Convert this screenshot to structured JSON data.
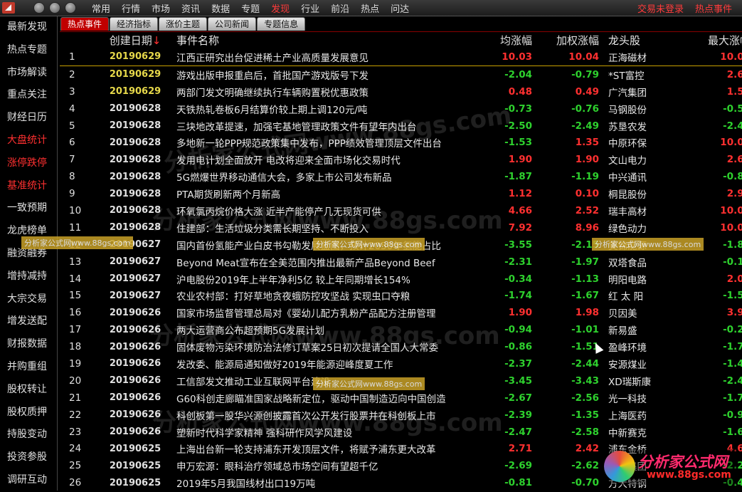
{
  "menu": {
    "items": [
      "常用",
      "行情",
      "市场",
      "资讯",
      "数据",
      "专题",
      "发现",
      "行业",
      "前沿",
      "热点",
      "问达"
    ],
    "active_index": 6,
    "login_status": "交易未登录",
    "hot_events": "热点事件"
  },
  "sidebar": {
    "items": [
      {
        "label": "最新发现",
        "red": false
      },
      {
        "label": "热点专题",
        "red": false
      },
      {
        "label": "市场解读",
        "red": false
      },
      {
        "label": "重点关注",
        "red": false
      },
      {
        "label": "财经日历",
        "red": false
      },
      {
        "label": "大盘统计",
        "red": true
      },
      {
        "label": "涨停跌停",
        "red": true
      },
      {
        "label": "基准统计",
        "red": true
      },
      {
        "label": "一致预期",
        "red": false
      },
      {
        "label": "龙虎榜单",
        "red": false
      },
      {
        "label": "融资融券",
        "red": false
      },
      {
        "label": "增持减持",
        "red": false
      },
      {
        "label": "大宗交易",
        "red": false
      },
      {
        "label": "增发送配",
        "red": false
      },
      {
        "label": "财报数据",
        "red": false
      },
      {
        "label": "并购重组",
        "red": false
      },
      {
        "label": "股权转让",
        "red": false
      },
      {
        "label": "股权质押",
        "red": false
      },
      {
        "label": "持股变动",
        "red": false
      },
      {
        "label": "投资参股",
        "red": false
      },
      {
        "label": "调研互动",
        "red": false
      }
    ]
  },
  "tabs": [
    "热点事件",
    "经济指标",
    "涨价主题",
    "公司新闻",
    "专题信息"
  ],
  "table": {
    "headers": {
      "no": "",
      "date": "创建日期",
      "sort_arrow": "↓",
      "name": "事件名称",
      "avg": "均涨幅",
      "weighted": "加权涨幅",
      "leader": "龙头股",
      "max": "最大涨幅"
    },
    "rows": [
      {
        "no": "1",
        "date": "20190629",
        "name": "江西正研究出台促进稀土产业高质量发展意见",
        "avg": "10.03",
        "w": "10.04",
        "leader": "正海磁材",
        "max": "10.05"
      },
      {
        "no": "2",
        "date": "20190629",
        "name": "游戏出版申报重启后，首批国产游戏版号下发",
        "avg": "-2.04",
        "w": "-0.79",
        "leader": "*ST富控",
        "max": "2.68"
      },
      {
        "no": "3",
        "date": "20190629",
        "name": "两部门发文明确继续执行车辆购置税优惠政策",
        "avg": "0.48",
        "w": "0.49",
        "leader": "广汽集团",
        "max": "1.58"
      },
      {
        "no": "4",
        "date": "20190628",
        "name": "天铁热轧卷板6月结算价较上期上调120元/吨",
        "avg": "-0.73",
        "w": "-0.76",
        "leader": "马钢股份",
        "max": "-0.58"
      },
      {
        "no": "5",
        "date": "20190628",
        "name": "三块地改革提速，加强宅基地管理政策文件有望年内出台",
        "avg": "-2.50",
        "w": "-2.49",
        "leader": "苏垦农发",
        "max": "-2.41"
      },
      {
        "no": "6",
        "date": "20190628",
        "name": "多地新一轮PPP规范政策集中发布，PPP绩效管理顶层文件出台",
        "avg": "-1.53",
        "w": "1.35",
        "leader": "中原环保",
        "max": "10.03"
      },
      {
        "no": "7",
        "date": "20190628",
        "name": "发用电计划全面放开 电改将迎来全面市场化交易时代",
        "avg": "1.90",
        "w": "1.90",
        "leader": "文山电力",
        "max": "2.68"
      },
      {
        "no": "8",
        "date": "20190628",
        "name": "5G燃爆世界移动通信大会，多家上市公司发布新品",
        "avg": "-1.87",
        "w": "-1.19",
        "leader": "中兴通讯",
        "max": "-0.85"
      },
      {
        "no": "9",
        "date": "20190628",
        "name": "PTA期货刷新两个月新高",
        "avg": "1.12",
        "w": "0.10",
        "leader": "桐昆股份",
        "max": "2.99"
      },
      {
        "no": "10",
        "date": "20190628",
        "name": "环氧氯丙烷价格大涨 近半产能停产几无现货可供",
        "avg": "4.66",
        "w": "2.52",
        "leader": "瑞丰高材",
        "max": "10.01"
      },
      {
        "no": "11",
        "date": "20190628",
        "name": "住建部：生活垃圾分类需长期坚持、不断投入",
        "avg": "7.92",
        "w": "8.96",
        "leader": "绿色动力",
        "max": "10.00"
      },
      {
        "no": "12",
        "date": "20190627",
        "name": "国内首份氢能产业白皮书勾勒发展蓝图，预计2050年氢能占比",
        "avg": "-3.55",
        "w": "-2.15",
        "leader": "美锦能源",
        "max": "-1.88"
      },
      {
        "no": "13",
        "date": "20190627",
        "name": "Beyond Meat宣布在全美范围内推出最新产品Beyond Beef",
        "avg": "-2.31",
        "w": "-1.97",
        "leader": "双塔食品",
        "max": "-0.14"
      },
      {
        "no": "14",
        "date": "20190627",
        "name": "沪电股份2019年上半年净利5亿 较上年同期增长154%",
        "avg": "-0.34",
        "w": "-1.13",
        "leader": "明阳电路",
        "max": "2.04"
      },
      {
        "no": "15",
        "date": "20190627",
        "name": "农业农村部：打好草地贪夜蛾防控攻坚战 实现虫口夺粮",
        "avg": "-1.74",
        "w": "-1.67",
        "leader": "红 太 阳",
        "max": "-1.53"
      },
      {
        "no": "16",
        "date": "20190626",
        "name": "国家市场监督管理总局对《婴幼儿配方乳粉产品配方注册管理",
        "avg": "1.90",
        "w": "1.98",
        "leader": "贝因美",
        "max": "3.99"
      },
      {
        "no": "17",
        "date": "20190626",
        "name": "两大运营商公布超预期5G发展计划",
        "avg": "-0.94",
        "w": "-1.01",
        "leader": "新易盛",
        "max": "-0.24"
      },
      {
        "no": "18",
        "date": "20190626",
        "name": "固体废物污染环境防治法修订草案25日初次提请全国人大常委",
        "avg": "-0.86",
        "w": "-1.51",
        "leader": "盈峰环境",
        "max": "-1.73"
      },
      {
        "no": "19",
        "date": "20190626",
        "name": "发改委、能源局通知做好2019年能源迎峰度夏工作",
        "avg": "-2.37",
        "w": "-2.44",
        "leader": "安源煤业",
        "max": "-1.46"
      },
      {
        "no": "20",
        "date": "20190626",
        "name": "工信部发文推动工业互联网平台建设",
        "avg": "-3.45",
        "w": "-3.43",
        "leader": "XD瑞斯康",
        "max": "-2.41"
      },
      {
        "no": "21",
        "date": "20190626",
        "name": "G60科创走廊瞄准国家战略新定位，驱动中国制造迈向中国创造",
        "avg": "-2.67",
        "w": "-2.56",
        "leader": "光一科技",
        "max": "-1.75"
      },
      {
        "no": "22",
        "date": "20190626",
        "name": "科创板第一股华兴源创披露首次公开发行股票并在科创板上市",
        "avg": "-2.39",
        "w": "-1.35",
        "leader": "上海医药",
        "max": "-0.93"
      },
      {
        "no": "23",
        "date": "20190626",
        "name": "塑新时代科学家精神 强科研作风学风建设",
        "avg": "-2.47",
        "w": "-2.58",
        "leader": "中新赛克",
        "max": "-1.60"
      },
      {
        "no": "24",
        "date": "20190625",
        "name": "上海出台新一轮支持浦东开发顶层文件，将赋予浦东更大改革",
        "avg": "2.71",
        "w": "2.42",
        "leader": "浦东金桥",
        "max": "4.66"
      },
      {
        "no": "25",
        "date": "20190625",
        "name": "申万宏源：眼科治疗领域总市场空间有望超千亿",
        "avg": "-2.69",
        "w": "-2.62",
        "leader": "光正集团",
        "max": "-2.27"
      },
      {
        "no": "26",
        "date": "20190625",
        "name": "2019年5月我国线材出口19万吨",
        "avg": "-0.81",
        "w": "-0.70",
        "leader": "方大特钢",
        "max": "-0.45"
      }
    ],
    "selected_row": 0,
    "yellow_date_rows": [
      0,
      1,
      2
    ]
  },
  "watermark": {
    "text": "分析家公式网www.88gs.com",
    "banner": "分析家公式网www.88gs.com"
  },
  "brand": {
    "name": "分析家公式网",
    "url": "www.88gs.com"
  }
}
